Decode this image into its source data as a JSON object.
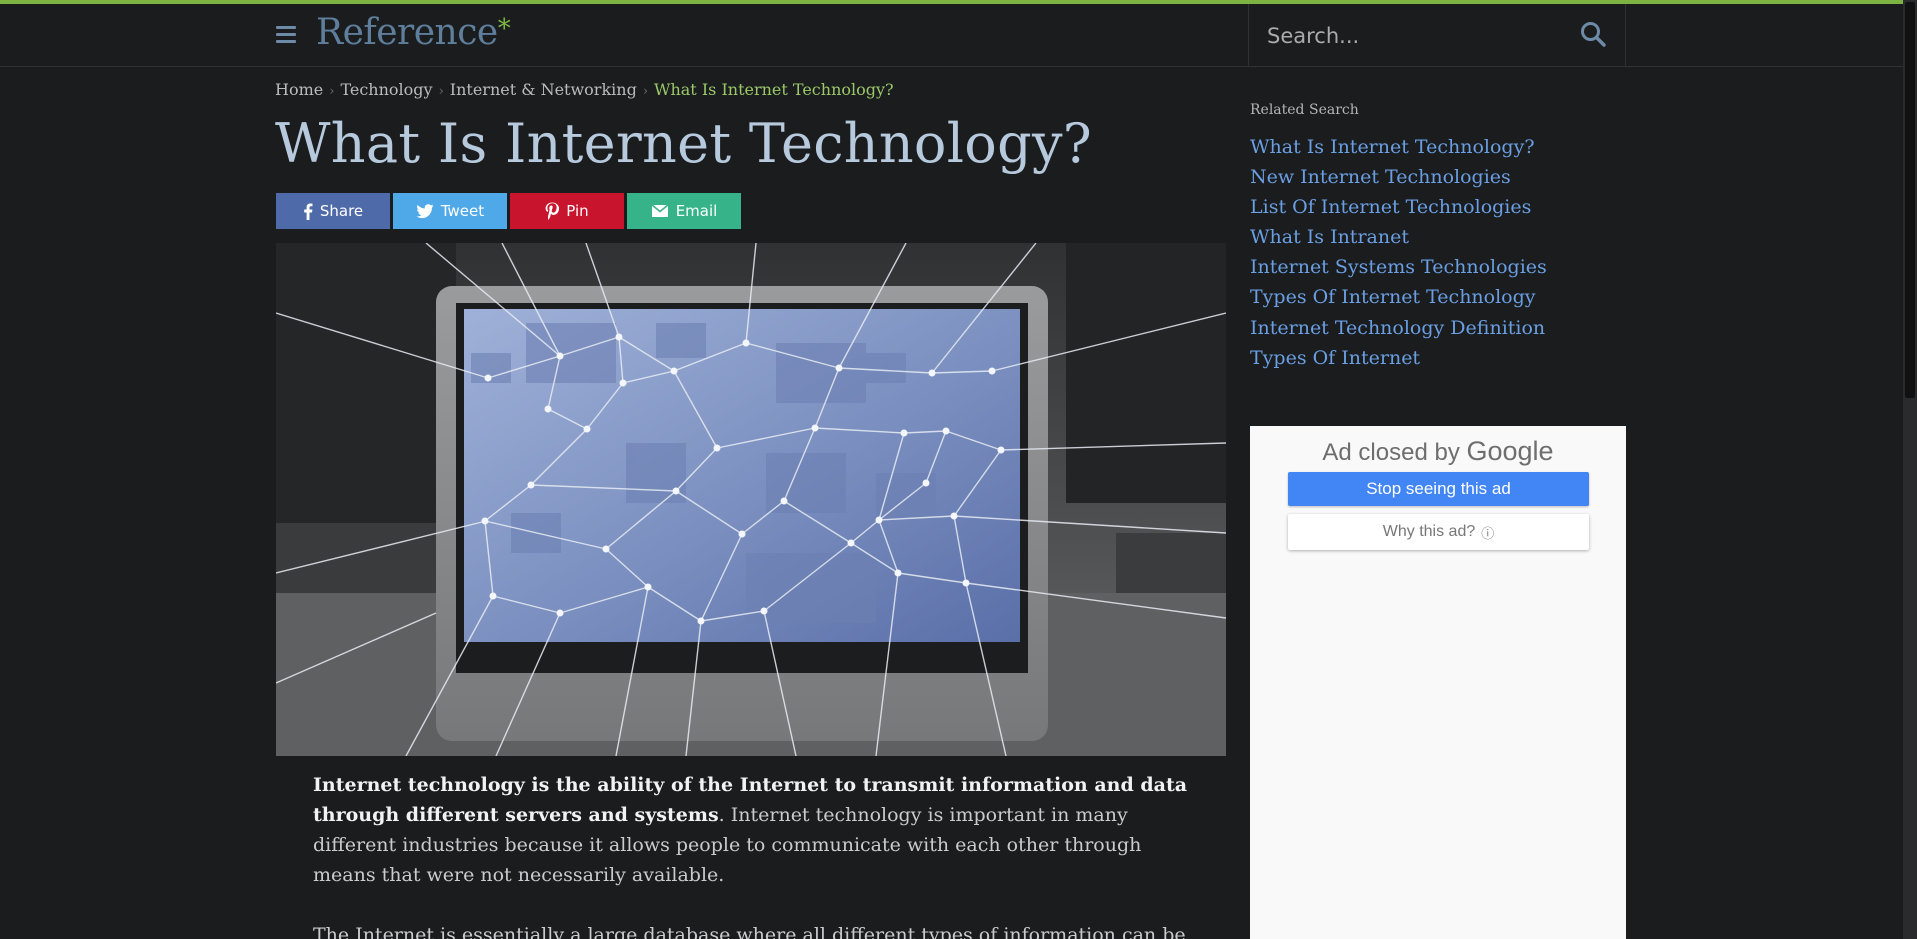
{
  "header": {
    "logo_text": "Reference",
    "logo_star": "*",
    "search_placeholder": "Search..."
  },
  "breadcrumb": {
    "items": [
      "Home",
      "Technology",
      "Internet & Networking"
    ],
    "current": "What Is Internet Technology?",
    "separator": "›"
  },
  "article": {
    "title": "What Is Internet Technology?",
    "share_buttons": [
      {
        "label": "Share",
        "icon": "facebook-icon",
        "color": "#4f6aa8"
      },
      {
        "label": "Tweet",
        "icon": "twitter-icon",
        "color": "#4fa9e8"
      },
      {
        "label": "Pin",
        "icon": "pinterest-icon",
        "color": "#c8142c"
      },
      {
        "label": "Email",
        "icon": "email-icon",
        "color": "#37b38a"
      }
    ],
    "lead_bold": "Internet technology is the ability of the Internet to transmit information and data through different servers and systems",
    "lead_rest": ". Internet technology is important in many different industries because it allows people to communicate with each other through means that were not necessarily available.",
    "para2": "The Internet is essentially a large database where all different types of information can be"
  },
  "sidebar": {
    "related_label": "Related Search",
    "related": [
      "What Is Internet Technology?",
      "New Internet Technologies",
      "List Of Internet Technologies",
      "What Is Intranet",
      "Internet Systems Technologies",
      "Types Of Internet Technology",
      "Internet Technology Definition",
      "Types Of Internet"
    ]
  },
  "ad": {
    "closed_prefix": "Ad closed by",
    "closed_brand": "Google",
    "stop_label": "Stop seeing this ad",
    "why_label": "Why this ad?",
    "why_info": "ⓘ"
  },
  "colors": {
    "accent": "#7cb342",
    "link": "#6a9fe3",
    "title": "#b7c9dc",
    "background": "#1b1c1e"
  }
}
